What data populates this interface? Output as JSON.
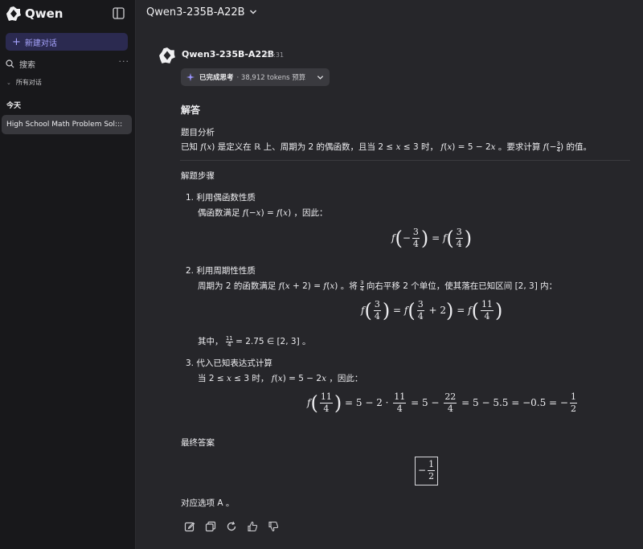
{
  "sidebar": {
    "logo_text": "Qwen",
    "new_chat": "新建对话",
    "search": "搜索",
    "more": "···",
    "all_chats": "所有对话",
    "today": "今天",
    "history": [
      "High School Math Problem Sol:::"
    ]
  },
  "header": {
    "model": "Qwen3-235B-A22B"
  },
  "message": {
    "name": "Qwen3-235B-A22B",
    "time": "00:31",
    "thinking_status": "已完成思考",
    "thinking_budget": "· 38,912 tokens 预算",
    "heading_answer": "解答",
    "analysis_title": "题目分析",
    "analysis_a": "已知",
    "analysis_b": "是定义在",
    "analysis_c": "上、周期为 2 的偶函数，且当",
    "analysis_d": "时，",
    "analysis_e": "。要求计算",
    "analysis_f": "的值。",
    "steps_title": "解题步骤",
    "step1_title": "1.  利用偶函数性质",
    "step1_a": "偶函数满足",
    "step1_b": "，因此：",
    "step2_title": "2.  利用周期性性质",
    "step2_a": "周期为 2 的函数满足",
    "step2_b": "。将",
    "step2_c": "向右平移 2 个单位，使其落在已知区间",
    "step2_d": "内：",
    "step2_note_a": "其中，",
    "step2_note_b": "。",
    "step3_title": "3.  代入已知表达式计算",
    "step3_a": "当",
    "step3_b": "时，",
    "step3_c": "，因此：",
    "final_title": "最终答案",
    "choice": "对应选项 A 。"
  }
}
